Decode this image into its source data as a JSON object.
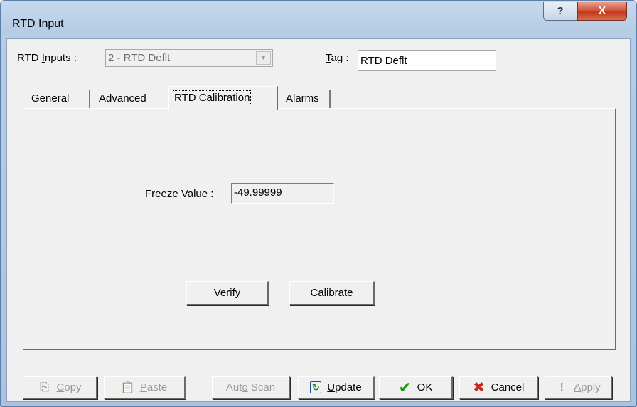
{
  "window": {
    "title": "RTD Input",
    "help_glyph": "?",
    "close_glyph": "X"
  },
  "header": {
    "rtd_inputs_label_pre": "RTD ",
    "rtd_inputs_label_u": "I",
    "rtd_inputs_label_post": "nputs :",
    "rtd_inputs_value": "2 - RTD Deflt",
    "tag_label_u": "T",
    "tag_label_post": "ag :",
    "tag_value": "RTD Deflt"
  },
  "tabs": [
    {
      "label": "General"
    },
    {
      "label": "Advanced"
    },
    {
      "label": "RTD Calibration",
      "selected": true
    },
    {
      "label": "Alarms"
    }
  ],
  "panel": {
    "freeze_label": "Freeze Value :",
    "freeze_value": "-49.99999",
    "verify_label": "Verify",
    "calibrate_label": "Calibrate"
  },
  "footer": {
    "copy_u": "C",
    "copy_rest": "opy",
    "paste_u": "P",
    "paste_rest": "aste",
    "autoscan_pre": "Aut",
    "autoscan_u": "o",
    "autoscan_post": " Scan",
    "update_u": "U",
    "update_rest": "pdate",
    "ok_label": "OK",
    "cancel_label": "Cancel",
    "apply_u": "A",
    "apply_rest": "pply"
  },
  "colors": {
    "accent_ok": "#1b9a1b",
    "accent_cancel": "#c8281c",
    "close_button": "#c23a1f"
  }
}
